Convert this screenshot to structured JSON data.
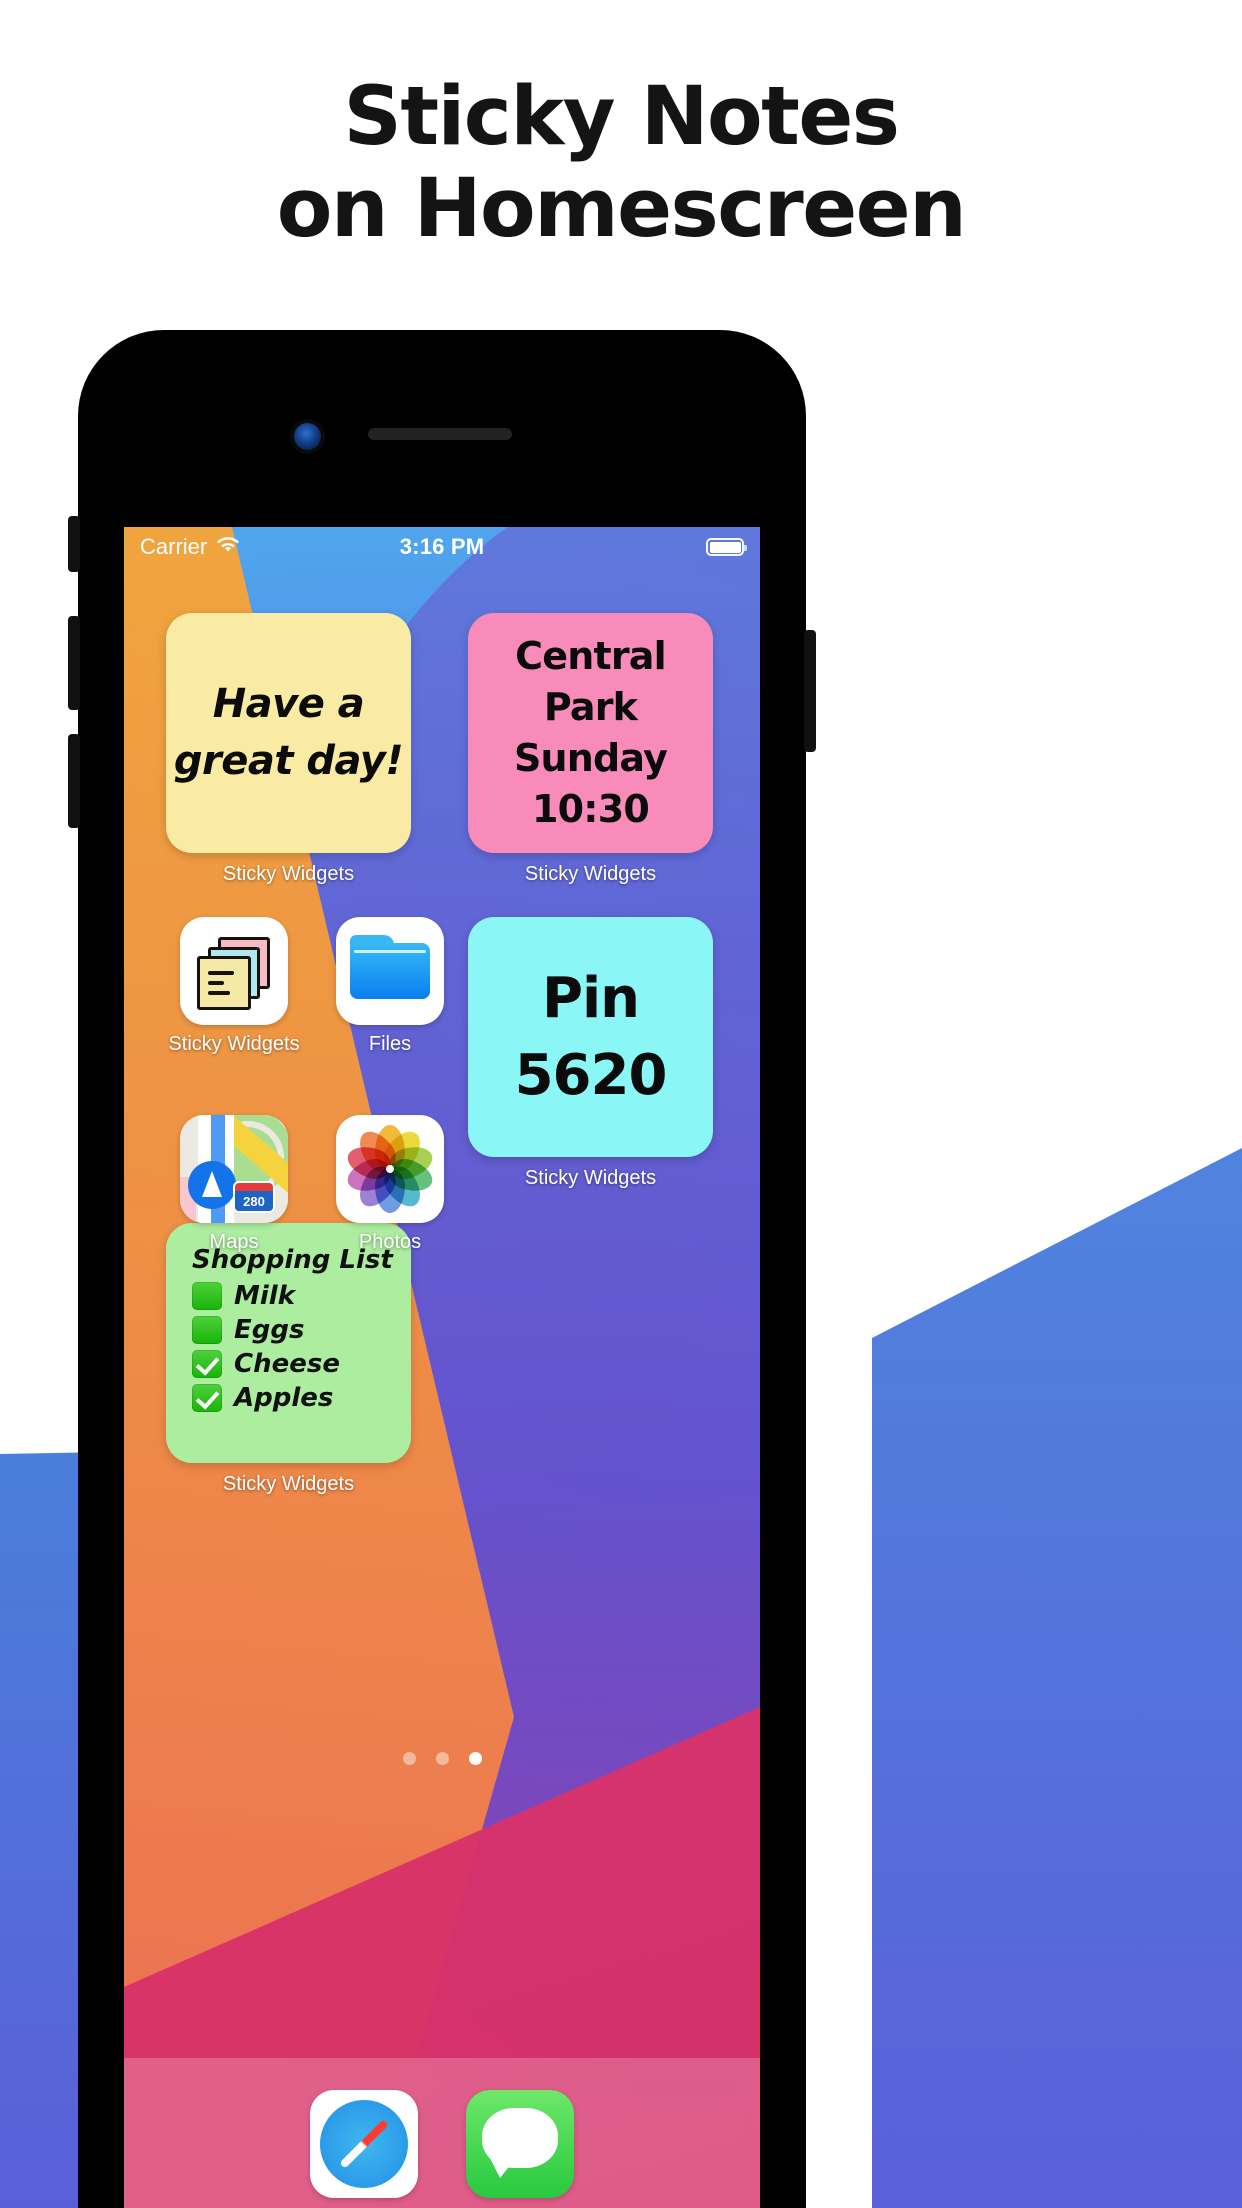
{
  "headline": {
    "line1": "Sticky Notes",
    "line2": "on Homescreen"
  },
  "colors": {
    "headline_text": "#141414",
    "note_yellow": "#f9eba4",
    "note_pink": "#f98bbb",
    "note_cyan": "#8bf6f6",
    "note_green": "#adeda0",
    "checkbox_green": "#18b408",
    "wallpaper_blue": "#4f7ce2",
    "wallpaper_orange": "#ee8f45",
    "wallpaper_magenta": "#e03a72"
  },
  "phone": {
    "statusbar": {
      "carrier": "Carrier",
      "wifi_icon": "wifi-icon",
      "time": "3:16 PM",
      "battery_icon": "battery-full-icon"
    },
    "widgets": [
      {
        "id": "yellow",
        "color": "#f9eba4",
        "lines": [
          "Have a",
          "great day!"
        ],
        "label": "Sticky Widgets"
      },
      {
        "id": "pink",
        "color": "#f98bbb",
        "lines": [
          "Central Park",
          "Sunday",
          "10:30"
        ],
        "label": "Sticky Widgets"
      },
      {
        "id": "cyan",
        "color": "#8bf6f6",
        "lines": [
          "Pin",
          "5620"
        ],
        "label": "Sticky Widgets"
      },
      {
        "id": "green",
        "color": "#adeda0",
        "title": "Shopping List",
        "items": [
          {
            "text": "Milk",
            "checked": false
          },
          {
            "text": "Eggs",
            "checked": false
          },
          {
            "text": "Cheese",
            "checked": true
          },
          {
            "text": "Apples",
            "checked": true
          }
        ],
        "label": "Sticky Widgets"
      }
    ],
    "apps": [
      {
        "id": "sticky",
        "label": "Sticky Widgets",
        "icon": "sticky-notes-stack-icon"
      },
      {
        "id": "files",
        "label": "Files",
        "icon": "folder-icon"
      },
      {
        "id": "maps",
        "label": "Maps",
        "icon": "map-icon",
        "route_shield": "280"
      },
      {
        "id": "photos",
        "label": "Photos",
        "icon": "pinwheel-icon"
      }
    ],
    "page_dots": {
      "count": 3,
      "active_index": 2
    },
    "dock": [
      {
        "id": "safari",
        "icon": "compass-icon"
      },
      {
        "id": "messages",
        "icon": "speech-bubble-icon"
      }
    ]
  }
}
